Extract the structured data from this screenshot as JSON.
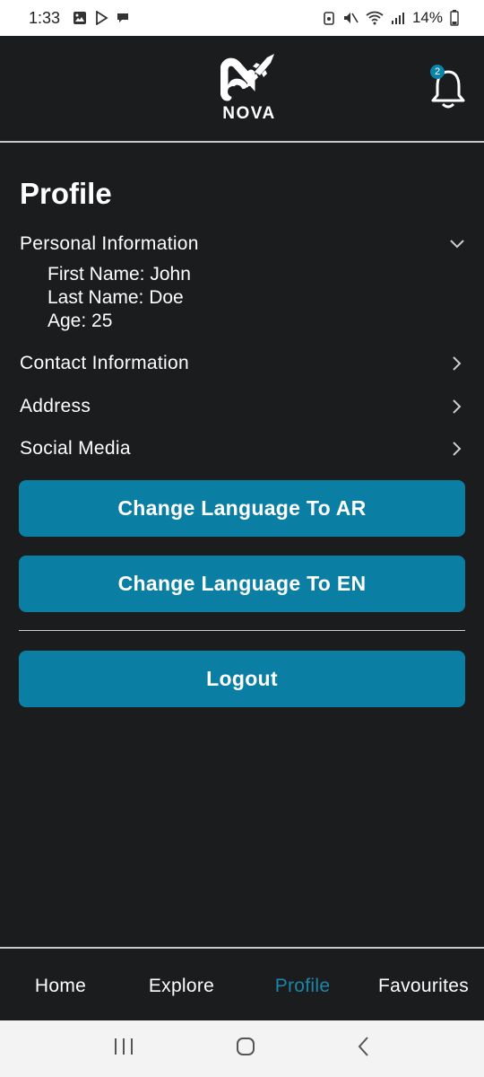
{
  "status_bar": {
    "time": "1:33",
    "battery": "14%",
    "icons_left": [
      "gallery-icon",
      "play-store-icon",
      "chat-icon"
    ],
    "icons_right": [
      "battery-saver-icon",
      "mute-icon",
      "wifi-icon",
      "signal-icon",
      "battery-icon"
    ]
  },
  "header": {
    "logo_text": "NOVA",
    "notification_count": "2"
  },
  "profile": {
    "title": "Profile",
    "sections": [
      {
        "label": "Personal Information",
        "expanded": true
      },
      {
        "label": "Contact Information",
        "expanded": false
      },
      {
        "label": "Address",
        "expanded": false
      },
      {
        "label": "Social Media",
        "expanded": false
      }
    ],
    "personal_info": {
      "first_name": "First Name: John",
      "last_name": "Last Name: Doe",
      "age": "Age: 25"
    },
    "buttons": {
      "lang_ar": "Change Language To AR",
      "lang_en": "Change Language To EN",
      "logout": "Logout"
    }
  },
  "bottom_nav": {
    "items": [
      {
        "label": "Home"
      },
      {
        "label": "Explore"
      },
      {
        "label": "Profile",
        "active": true
      },
      {
        "label": "Favourites"
      }
    ]
  },
  "colors": {
    "accent": "#0b7fa3",
    "background": "#1b1c1e",
    "active_nav": "#1a86aa"
  }
}
